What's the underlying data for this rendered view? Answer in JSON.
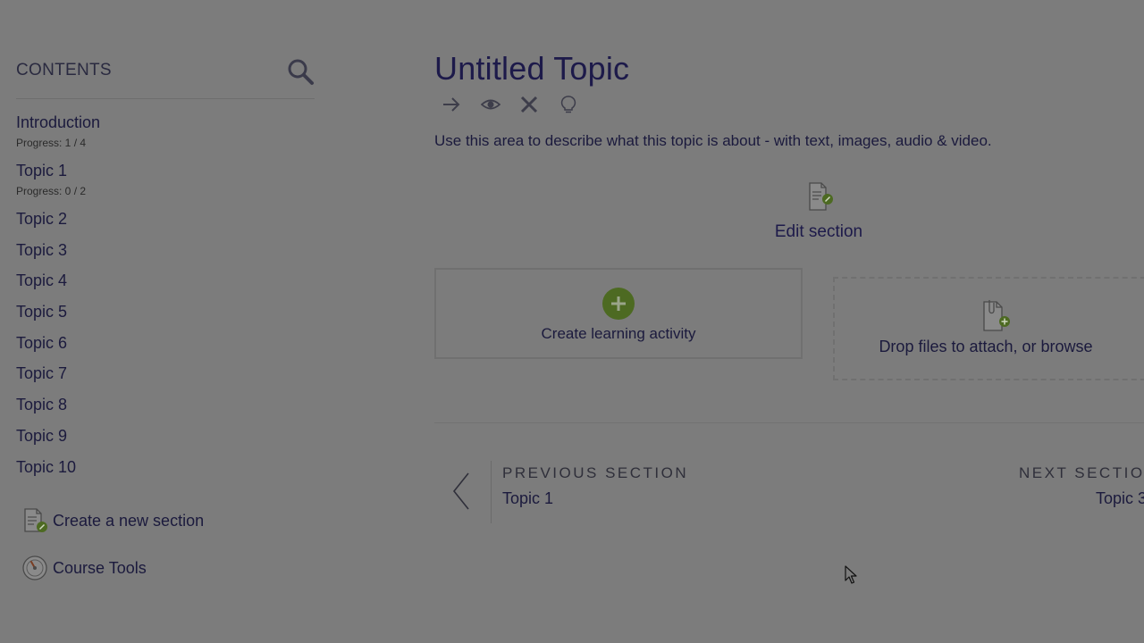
{
  "sidebar": {
    "title": "CONTENTS",
    "search_icon": "search-icon",
    "items": [
      {
        "label": "Introduction",
        "progress": "Progress: 1 / 4"
      },
      {
        "label": "Topic 1",
        "progress": "Progress: 0 / 2"
      },
      {
        "label": "Topic 2"
      },
      {
        "label": "Topic 3"
      },
      {
        "label": "Topic 4"
      },
      {
        "label": "Topic 5"
      },
      {
        "label": "Topic 6"
      },
      {
        "label": "Topic 7"
      },
      {
        "label": "Topic 8"
      },
      {
        "label": "Topic 9"
      },
      {
        "label": "Topic 10"
      }
    ],
    "create_section_label": "Create a new section",
    "course_tools_label": "Course Tools"
  },
  "main": {
    "title": "Untitled Topic",
    "toolbar_icons": [
      "arrow-right-icon",
      "eye-icon",
      "close-icon",
      "lightbulb-icon"
    ],
    "description": "Use this area to describe what this topic is about - with text, images, audio & video.",
    "edit_section_label": "Edit section",
    "create_activity_label": "Create learning activity",
    "dropzone_text": "Drop files to attach, or ",
    "dropzone_browse": "browse",
    "previous": {
      "label": "PREVIOUS SECTION",
      "target": "Topic 1"
    },
    "next": {
      "label": "NEXT SECTION",
      "target": "Topic 3"
    }
  },
  "colors": {
    "overlay_bg": "#7c7c7c",
    "text": "#1b1a3d",
    "accent_green": "#4d6a22"
  }
}
